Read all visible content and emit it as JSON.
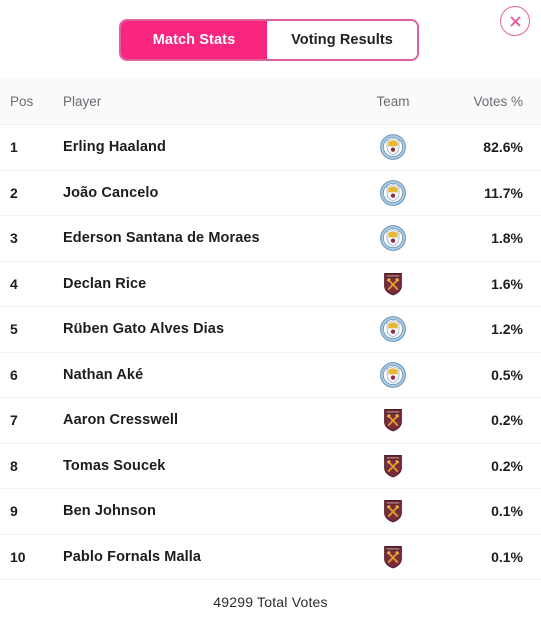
{
  "tabs": [
    {
      "label": "Match Stats",
      "active": true
    },
    {
      "label": "Voting Results",
      "active": false
    }
  ],
  "close_button": {
    "icon": "close-icon",
    "color": "#e8619f"
  },
  "table": {
    "headers": {
      "pos": "Pos",
      "player": "Player",
      "team": "Team",
      "votes": "Votes %"
    },
    "rows": [
      {
        "pos": "1",
        "player": "Erling Haaland",
        "team": "manchester-city",
        "team_name": "Manchester City",
        "votes": "82.6%"
      },
      {
        "pos": "2",
        "player": "João Cancelo",
        "team": "manchester-city",
        "team_name": "Manchester City",
        "votes": "11.7%"
      },
      {
        "pos": "3",
        "player": "Ederson Santana de Moraes",
        "team": "manchester-city",
        "team_name": "Manchester City",
        "votes": "1.8%"
      },
      {
        "pos": "4",
        "player": "Declan Rice",
        "team": "west-ham",
        "team_name": "West Ham United",
        "votes": "1.6%"
      },
      {
        "pos": "5",
        "player": "Rüben Gato Alves Dias",
        "team": "manchester-city",
        "team_name": "Manchester City",
        "votes": "1.2%"
      },
      {
        "pos": "6",
        "player": "Nathan Aké",
        "team": "manchester-city",
        "team_name": "Manchester City",
        "votes": "0.5%"
      },
      {
        "pos": "7",
        "player": "Aaron Cresswell",
        "team": "west-ham",
        "team_name": "West Ham United",
        "votes": "0.2%"
      },
      {
        "pos": "8",
        "player": "Tomas Soucek",
        "team": "west-ham",
        "team_name": "West Ham United",
        "votes": "0.2%"
      },
      {
        "pos": "9",
        "player": "Ben Johnson",
        "team": "west-ham",
        "team_name": "West Ham United",
        "votes": "0.1%"
      },
      {
        "pos": "10",
        "player": "Pablo Fornals Malla",
        "team": "west-ham",
        "team_name": "West Ham United",
        "votes": "0.1%"
      }
    ]
  },
  "footer": {
    "total_votes": "49299 Total Votes"
  },
  "colors": {
    "accent_pink": "#f9257f",
    "tab_border": "#e0609b",
    "close_ring": "#e8619f",
    "header_bg": "#fafafa",
    "text_dark": "#1d1d20",
    "text_muted": "#6b6b73",
    "divider": "#f1f1f1",
    "man_city_blue": "#9fc5e8",
    "west_ham_claret": "#7c2c3b",
    "west_ham_gold": "#d4a017"
  }
}
